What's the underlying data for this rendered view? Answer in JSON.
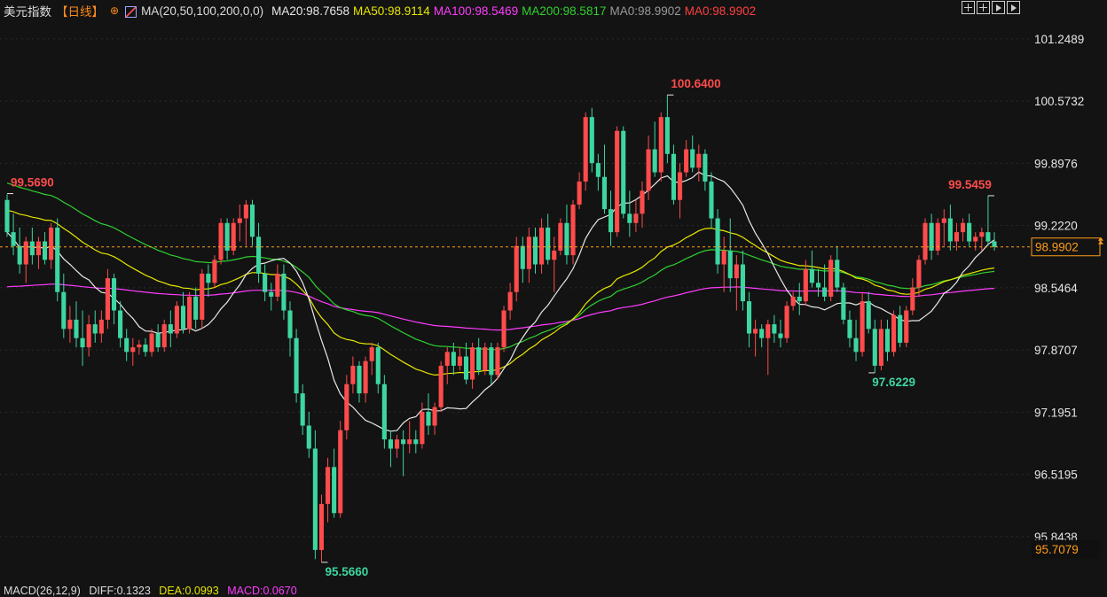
{
  "header": {
    "symbol": "美元指数",
    "period": "【日线】",
    "ma_params": "MA(20,50,100,200,0,0)",
    "ma_items": [
      {
        "label": "MA20:98.7658",
        "color": "#e8e8e8"
      },
      {
        "label": "MA50:98.9114",
        "color": "#e6e600"
      },
      {
        "label": "MA100:98.5469",
        "color": "#ff3cff"
      },
      {
        "label": "MA200:98.5817",
        "color": "#2fd22f"
      },
      {
        "label": "MA0:98.9902",
        "color": "#9a9a9a"
      },
      {
        "label": "MA0:98.9902",
        "color": "#ff4040"
      }
    ]
  },
  "toolbar_icons": [
    "zoom-in-icon",
    "zoom-out-icon",
    "play-icon",
    "step-icon"
  ],
  "footer": {
    "macd_label": "MACD(26,12,9)",
    "diff_label": "DIFF:0.1323",
    "dea_label": "DEA:0.0993",
    "macd_value_label": "MACD:0.0670"
  },
  "chart_data": {
    "type": "candlestick",
    "ylim": [
      95.42,
      101.44
    ],
    "y_ticks": [
      "101.2489",
      "100.5732",
      "99.8976",
      "99.2220",
      "98.5464",
      "97.8707",
      "97.1951",
      "96.5195",
      "95.8438"
    ],
    "current_price": "98.9902",
    "last_marker": "95.7079",
    "annotations": [
      {
        "text": "99.5690",
        "value": 99.569,
        "index": 0,
        "color": "#ff4b4b"
      },
      {
        "text": "95.5660",
        "value": 95.566,
        "index": 50,
        "color": "#3dd6a0"
      },
      {
        "text": "100.6400",
        "value": 100.64,
        "index": 105,
        "color": "#ff4b4b"
      },
      {
        "text": "97.6229",
        "value": 97.6229,
        "index": 137,
        "color": "#3dd6a0"
      },
      {
        "text": "99.5459",
        "value": 99.5459,
        "index": 156,
        "color": "#ff4b4b"
      }
    ],
    "colors": {
      "up": "#ff4b4b",
      "down": "#3dd6a0",
      "ma20": "#e8e8e8",
      "ma50": "#e6e600",
      "ma100": "#ff3cff",
      "ma200": "#2fd22f",
      "grid": "#2b2b2b",
      "axis_text": "#e6e6e6",
      "price_line": "#ff9d1a"
    },
    "candles": [
      [
        99.5,
        99.56,
        99.1,
        99.15
      ],
      [
        99.15,
        99.35,
        98.9,
        99.0
      ],
      [
        99.0,
        99.2,
        98.7,
        98.8
      ],
      [
        98.8,
        99.1,
        98.6,
        99.05
      ],
      [
        99.05,
        99.2,
        98.8,
        98.9
      ],
      [
        98.9,
        99.1,
        98.75,
        99.05
      ],
      [
        99.05,
        99.15,
        98.8,
        98.85
      ],
      [
        98.85,
        99.25,
        98.75,
        99.2
      ],
      [
        99.2,
        99.3,
        98.4,
        98.5
      ],
      [
        98.5,
        98.7,
        98.0,
        98.1
      ],
      [
        98.1,
        98.35,
        97.95,
        98.2
      ],
      [
        98.2,
        98.4,
        97.9,
        98.0
      ],
      [
        98.0,
        98.3,
        97.7,
        97.9
      ],
      [
        97.9,
        98.25,
        97.8,
        98.15
      ],
      [
        98.15,
        98.3,
        97.95,
        98.05
      ],
      [
        98.05,
        98.3,
        97.95,
        98.2
      ],
      [
        98.2,
        98.75,
        98.1,
        98.65
      ],
      [
        98.65,
        98.7,
        98.15,
        98.3
      ],
      [
        98.3,
        98.4,
        97.9,
        98.0
      ],
      [
        98.0,
        98.1,
        97.75,
        97.85
      ],
      [
        97.85,
        98.0,
        97.7,
        97.9
      ],
      [
        97.9,
        97.98,
        97.82,
        97.93
      ],
      [
        97.93,
        98.0,
        97.8,
        97.85
      ],
      [
        97.85,
        98.1,
        97.8,
        98.05
      ],
      [
        98.05,
        98.15,
        97.85,
        97.9
      ],
      [
        97.9,
        98.2,
        97.85,
        98.15
      ],
      [
        98.15,
        98.3,
        97.9,
        98.05
      ],
      [
        98.05,
        98.4,
        98.0,
        98.35
      ],
      [
        98.35,
        98.5,
        98.05,
        98.1
      ],
      [
        98.1,
        98.5,
        98.05,
        98.45
      ],
      [
        98.45,
        98.55,
        98.1,
        98.2
      ],
      [
        98.2,
        98.75,
        98.1,
        98.7
      ],
      [
        98.7,
        98.8,
        98.45,
        98.6
      ],
      [
        98.6,
        98.9,
        98.55,
        98.85
      ],
      [
        98.85,
        99.3,
        98.8,
        99.25
      ],
      [
        99.25,
        99.3,
        98.85,
        98.95
      ],
      [
        98.95,
        99.3,
        98.9,
        99.25
      ],
      [
        99.25,
        99.45,
        99.05,
        99.3
      ],
      [
        99.3,
        99.5,
        99.0,
        99.45
      ],
      [
        99.45,
        99.5,
        99.0,
        99.1
      ],
      [
        99.1,
        99.25,
        98.6,
        98.7
      ],
      [
        98.7,
        98.8,
        98.4,
        98.5
      ],
      [
        98.5,
        98.6,
        98.3,
        98.45
      ],
      [
        98.45,
        98.8,
        98.4,
        98.7
      ],
      [
        98.7,
        98.8,
        98.2,
        98.3
      ],
      [
        98.3,
        98.4,
        97.8,
        98.0
      ],
      [
        98.0,
        98.1,
        97.3,
        97.4
      ],
      [
        97.4,
        97.5,
        96.95,
        97.05
      ],
      [
        97.05,
        97.2,
        96.7,
        96.8
      ],
      [
        96.8,
        97.0,
        95.6,
        95.7
      ],
      [
        95.7,
        96.3,
        95.566,
        96.2
      ],
      [
        96.2,
        96.7,
        96.0,
        96.6
      ],
      [
        96.6,
        96.8,
        96.05,
        96.1
      ],
      [
        96.1,
        97.1,
        96.05,
        97.0
      ],
      [
        97.0,
        97.6,
        96.9,
        97.5
      ],
      [
        97.5,
        97.8,
        97.4,
        97.7
      ],
      [
        97.7,
        97.75,
        97.3,
        97.4
      ],
      [
        97.4,
        97.8,
        97.3,
        97.75
      ],
      [
        97.75,
        97.95,
        97.6,
        97.9
      ],
      [
        97.9,
        97.95,
        97.4,
        97.5
      ],
      [
        97.5,
        97.6,
        96.8,
        96.9
      ],
      [
        96.9,
        97.0,
        96.6,
        96.8
      ],
      [
        96.8,
        96.95,
        96.7,
        96.9
      ],
      [
        96.9,
        97.0,
        96.5,
        96.85
      ],
      [
        96.85,
        97.1,
        96.75,
        96.9
      ],
      [
        96.9,
        97.0,
        96.75,
        96.85
      ],
      [
        96.85,
        97.3,
        96.8,
        97.2
      ],
      [
        97.2,
        97.4,
        96.95,
        97.05
      ],
      [
        97.05,
        97.3,
        96.95,
        97.25
      ],
      [
        97.25,
        97.75,
        97.2,
        97.7
      ],
      [
        97.7,
        97.9,
        97.5,
        97.85
      ],
      [
        97.85,
        97.95,
        97.6,
        97.7
      ],
      [
        97.7,
        97.9,
        97.65,
        97.8
      ],
      [
        97.8,
        97.95,
        97.5,
        97.55
      ],
      [
        97.55,
        97.95,
        97.45,
        97.9
      ],
      [
        97.9,
        98.0,
        97.6,
        97.65
      ],
      [
        97.65,
        97.95,
        97.6,
        97.9
      ],
      [
        97.9,
        97.95,
        97.5,
        97.6
      ],
      [
        97.6,
        97.95,
        97.55,
        97.9
      ],
      [
        97.9,
        98.35,
        97.85,
        98.3
      ],
      [
        98.3,
        98.6,
        98.2,
        98.5
      ],
      [
        98.5,
        99.1,
        98.4,
        99.0
      ],
      [
        99.0,
        99.1,
        98.6,
        98.75
      ],
      [
        98.75,
        99.2,
        98.6,
        99.1
      ],
      [
        99.1,
        99.2,
        98.7,
        98.8
      ],
      [
        98.8,
        99.3,
        98.7,
        99.2
      ],
      [
        99.2,
        99.35,
        98.8,
        98.85
      ],
      [
        98.85,
        99.1,
        98.5,
        98.95
      ],
      [
        98.95,
        99.3,
        98.9,
        99.25
      ],
      [
        99.25,
        99.45,
        98.8,
        98.9
      ],
      [
        98.9,
        99.5,
        98.8,
        99.45
      ],
      [
        99.45,
        99.8,
        99.4,
        99.7
      ],
      [
        99.7,
        100.45,
        99.6,
        100.4
      ],
      [
        100.4,
        100.5,
        99.8,
        99.9
      ],
      [
        99.9,
        100.0,
        99.6,
        99.75
      ],
      [
        99.75,
        100.1,
        99.35,
        99.4
      ],
      [
        99.4,
        99.6,
        99.0,
        99.15
      ],
      [
        99.15,
        100.3,
        99.1,
        100.25
      ],
      [
        100.25,
        100.3,
        99.3,
        99.35
      ],
      [
        99.35,
        99.6,
        99.1,
        99.25
      ],
      [
        99.25,
        99.5,
        99.15,
        99.35
      ],
      [
        99.35,
        99.7,
        99.2,
        99.6
      ],
      [
        99.6,
        100.2,
        99.5,
        100.05
      ],
      [
        100.05,
        100.35,
        99.75,
        99.8
      ],
      [
        99.8,
        100.45,
        99.7,
        100.4
      ],
      [
        100.4,
        100.64,
        99.9,
        100.0
      ],
      [
        100.0,
        100.1,
        99.45,
        99.5
      ],
      [
        99.5,
        99.9,
        99.3,
        99.8
      ],
      [
        99.8,
        100.15,
        99.75,
        100.05
      ],
      [
        100.05,
        100.2,
        99.8,
        99.85
      ],
      [
        99.85,
        100.1,
        99.7,
        100.0
      ],
      [
        100.0,
        100.05,
        99.6,
        99.7
      ],
      [
        99.7,
        99.8,
        99.2,
        99.3
      ],
      [
        99.3,
        99.4,
        98.7,
        98.8
      ],
      [
        98.8,
        99.1,
        98.5,
        98.95
      ],
      [
        98.95,
        99.3,
        98.5,
        98.65
      ],
      [
        98.65,
        98.9,
        98.3,
        98.8
      ],
      [
        98.8,
        98.95,
        98.3,
        98.4
      ],
      [
        98.4,
        98.5,
        97.9,
        98.05
      ],
      [
        98.05,
        98.2,
        97.8,
        98.1
      ],
      [
        98.1,
        98.15,
        97.9,
        98.0
      ],
      [
        98.0,
        98.2,
        97.6,
        98.15
      ],
      [
        98.15,
        98.25,
        97.95,
        98.05
      ],
      [
        98.05,
        98.2,
        97.9,
        98.0
      ],
      [
        98.0,
        98.4,
        97.95,
        98.35
      ],
      [
        98.35,
        98.5,
        98.3,
        98.45
      ],
      [
        98.45,
        98.6,
        98.25,
        98.4
      ],
      [
        98.4,
        98.85,
        98.35,
        98.75
      ],
      [
        98.75,
        98.95,
        98.55,
        98.6
      ],
      [
        98.6,
        98.75,
        98.45,
        98.55
      ],
      [
        98.55,
        98.8,
        98.4,
        98.45
      ],
      [
        98.45,
        98.9,
        98.4,
        98.85
      ],
      [
        98.85,
        99.0,
        98.5,
        98.55
      ],
      [
        98.55,
        98.6,
        98.15,
        98.2
      ],
      [
        98.2,
        98.3,
        97.9,
        98.0
      ],
      [
        98.0,
        98.2,
        97.75,
        97.85
      ],
      [
        97.85,
        98.5,
        97.8,
        98.4
      ],
      [
        98.4,
        98.5,
        98.05,
        98.1
      ],
      [
        98.1,
        98.2,
        97.6229,
        97.7
      ],
      [
        97.7,
        98.2,
        97.65,
        98.1
      ],
      [
        98.1,
        98.2,
        97.75,
        97.85
      ],
      [
        97.85,
        98.3,
        97.8,
        98.25
      ],
      [
        98.25,
        98.35,
        97.9,
        97.95
      ],
      [
        97.95,
        98.35,
        97.9,
        98.3
      ],
      [
        98.3,
        98.65,
        98.25,
        98.55
      ],
      [
        98.55,
        98.9,
        98.45,
        98.85
      ],
      [
        98.85,
        99.3,
        98.8,
        99.25
      ],
      [
        99.25,
        99.35,
        98.85,
        98.95
      ],
      [
        98.95,
        99.3,
        98.9,
        99.25
      ],
      [
        99.25,
        99.4,
        99.0,
        99.3
      ],
      [
        99.3,
        99.45,
        98.95,
        99.05
      ],
      [
        99.05,
        99.25,
        98.95,
        99.15
      ],
      [
        99.15,
        99.3,
        99.05,
        99.25
      ],
      [
        99.25,
        99.35,
        99.0,
        99.05
      ],
      [
        99.05,
        99.15,
        98.95,
        99.1
      ],
      [
        99.1,
        99.2,
        98.95,
        99.15
      ],
      [
        99.15,
        99.5459,
        99.0,
        99.05
      ],
      [
        99.05,
        99.15,
        98.95,
        98.99
      ]
    ]
  }
}
